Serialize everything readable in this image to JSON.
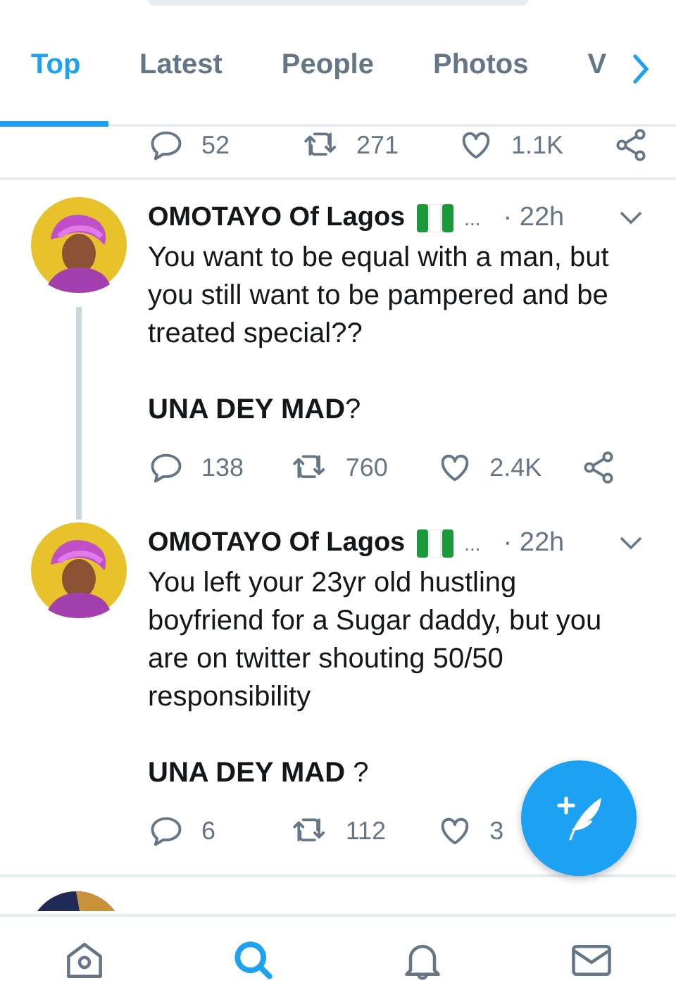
{
  "tabs": [
    {
      "label": "Top",
      "selected": true
    },
    {
      "label": "Latest",
      "selected": false
    },
    {
      "label": "People",
      "selected": false
    },
    {
      "label": "Photos",
      "selected": false
    },
    {
      "label": "V",
      "selected": false
    }
  ],
  "previous_tweet_stats": {
    "replies": "52",
    "retweets": "271",
    "likes": "1.1K"
  },
  "tweets": [
    {
      "name": "OMOTAYO Of Lagos",
      "more": "...",
      "time": "· 22h",
      "paragraphs": [
        "You want to be equal with a man, but you still want to be pampered and be treated special??",
        "**UNA DEY MAD**?"
      ],
      "thread_below": true,
      "replies": "138",
      "retweets": "760",
      "likes": "2.4K"
    },
    {
      "name": "OMOTAYO Of Lagos",
      "more": "...",
      "time": "· 22h",
      "paragraphs": [
        "You left your 23yr old hustling boyfriend for a Sugar daddy, but you are on twitter shouting 50/50 responsibility",
        "**UNA DEY MAD** ?"
      ],
      "thread_below": false,
      "replies": "6",
      "retweets": "112",
      "likes": "3"
    }
  ],
  "nav": [
    {
      "kind": "home",
      "selected": false
    },
    {
      "kind": "search",
      "selected": true
    },
    {
      "kind": "notifications",
      "selected": false
    },
    {
      "kind": "messages",
      "selected": false
    }
  ]
}
